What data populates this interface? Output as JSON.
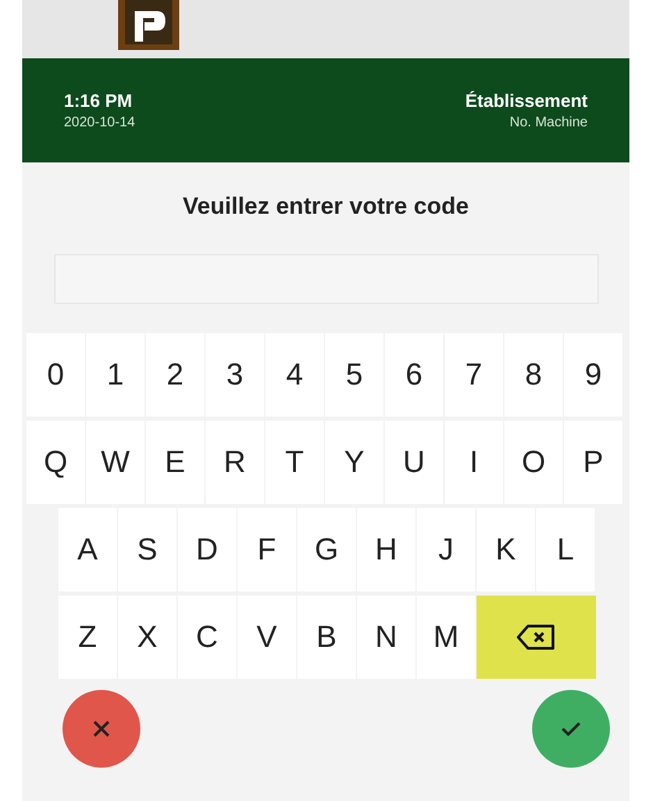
{
  "header": {
    "time": "1:16 PM",
    "date": "2020-10-14",
    "establishment": "Établissement",
    "machine": "No. Machine"
  },
  "prompt": "Veuillez entrer votre code",
  "keyboard": [
    [
      {
        "kind": "char",
        "label": "0"
      },
      {
        "kind": "char",
        "label": "1"
      },
      {
        "kind": "char",
        "label": "2"
      },
      {
        "kind": "char",
        "label": "3"
      },
      {
        "kind": "char",
        "label": "4"
      },
      {
        "kind": "char",
        "label": "5"
      },
      {
        "kind": "char",
        "label": "6"
      },
      {
        "kind": "char",
        "label": "7"
      },
      {
        "kind": "char",
        "label": "8"
      },
      {
        "kind": "char",
        "label": "9"
      }
    ],
    [
      {
        "kind": "char",
        "label": "Q"
      },
      {
        "kind": "char",
        "label": "W"
      },
      {
        "kind": "char",
        "label": "E"
      },
      {
        "kind": "char",
        "label": "R"
      },
      {
        "kind": "char",
        "label": "T"
      },
      {
        "kind": "char",
        "label": "Y"
      },
      {
        "kind": "char",
        "label": "U"
      },
      {
        "kind": "char",
        "label": "I"
      },
      {
        "kind": "char",
        "label": "O"
      },
      {
        "kind": "char",
        "label": "P"
      }
    ],
    [
      {
        "kind": "char",
        "label": "A"
      },
      {
        "kind": "char",
        "label": "S"
      },
      {
        "kind": "char",
        "label": "D"
      },
      {
        "kind": "char",
        "label": "F"
      },
      {
        "kind": "char",
        "label": "G"
      },
      {
        "kind": "char",
        "label": "H"
      },
      {
        "kind": "char",
        "label": "J"
      },
      {
        "kind": "char",
        "label": "K"
      },
      {
        "kind": "char",
        "label": "L"
      }
    ],
    [
      {
        "kind": "char",
        "label": "Z"
      },
      {
        "kind": "char",
        "label": "X"
      },
      {
        "kind": "char",
        "label": "C"
      },
      {
        "kind": "char",
        "label": "V"
      },
      {
        "kind": "char",
        "label": "B"
      },
      {
        "kind": "char",
        "label": "N"
      },
      {
        "kind": "char",
        "label": "M"
      },
      {
        "kind": "backspace"
      }
    ]
  ],
  "actions": [
    {
      "kind": "cancel"
    },
    {
      "kind": "confirm"
    }
  ]
}
